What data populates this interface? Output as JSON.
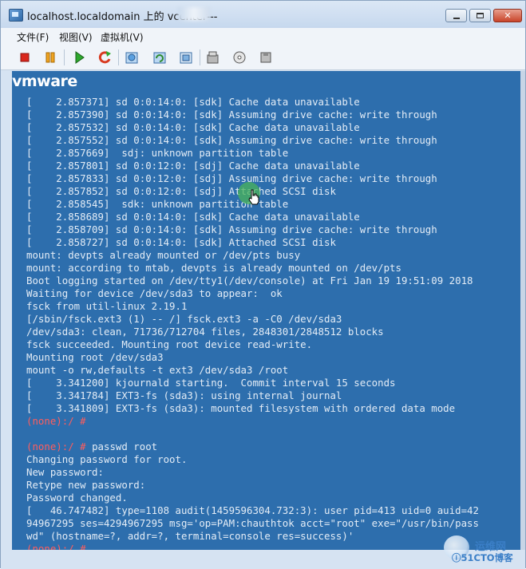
{
  "window": {
    "title": "localhost.localdomain 上的 vcenter---",
    "controls": {
      "minimize": "",
      "maximize": "",
      "close": "✕"
    }
  },
  "menubar": [
    "文件(F)",
    "视图(V)",
    "虚拟机(V)"
  ],
  "toolbar": {
    "buttons": [
      "stop-icon",
      "pause-icon",
      "play-icon",
      "reset-icon",
      "snapshot-icon",
      "revert-snapshot-icon",
      "manage-snapshots-icon",
      "vm-settings-icon",
      "cd-icon",
      "floppy-icon"
    ]
  },
  "console": {
    "logo": "vmware",
    "lines": [
      "[    2.857371] sd 0:0:14:0: [sdk] Cache data unavailable",
      "[    2.857390] sd 0:0:14:0: [sdk] Assuming drive cache: write through",
      "[    2.857532] sd 0:0:14:0: [sdk] Cache data unavailable",
      "[    2.857552] sd 0:0:14:0: [sdk] Assuming drive cache: write through",
      "[    2.857669]  sdj: unknown partition table",
      "[    2.857801] sd 0:0:12:0: [sdj] Cache data unavailable",
      "[    2.857833] sd 0:0:12:0: [sdj] Assuming drive cache: write through",
      "[    2.857852] sd 0:0:12:0: [sdj] Attached SCSI disk",
      "[    2.858545]  sdk: unknown partition table",
      "[    2.858689] sd 0:0:14:0: [sdk] Cache data unavailable",
      "[    2.858709] sd 0:0:14:0: [sdk] Assuming drive cache: write through",
      "[    2.858727] sd 0:0:14:0: [sdk] Attached SCSI disk",
      "mount: devpts already mounted or /dev/pts busy",
      "mount: according to mtab, devpts is already mounted on /dev/pts",
      "Boot logging started on /dev/tty1(/dev/console) at Fri Jan 19 19:51:09 2018",
      "Waiting for device /dev/sda3 to appear:  ok",
      "fsck from util-linux 2.19.1",
      "[/sbin/fsck.ext3 (1) -- /] fsck.ext3 -a -C0 /dev/sda3",
      "/dev/sda3: clean, 71736/712704 files, 2848301/2848512 blocks",
      "fsck succeeded. Mounting root device read-write.",
      "Mounting root /dev/sda3",
      "mount -o rw,defaults -t ext3 /dev/sda3 /root",
      "[    3.341200] kjournald starting.  Commit interval 15 seconds",
      "[    3.341784] EXT3-fs (sda3): using internal journal",
      "[    3.341809] EXT3-fs (sda3): mounted filesystem with ordered data mode",
      "(none):/ #",
      "",
      "(none):/ # passwd root",
      "Changing password for root.",
      "New password:",
      "Retype new password:",
      "Password changed.",
      "[   46.747482] type=1108 audit(1459596304.732:3): user pid=413 uid=0 auid=42",
      "94967295 ses=4294967295 msg='op=PAM:chauthtok acct=\"root\" exe=\"/usr/bin/pass",
      "wd\" (hostname=?, addr=?, terminal=console res=success)'",
      "(none):/ #"
    ],
    "prompt": "(none):/ #",
    "passwd_command": " passwd root"
  },
  "watermark": {
    "cn": "运维网",
    "en": "ⓘ51CTO博客"
  },
  "colors": {
    "console_bg": "#2d6ead",
    "console_text": "#e3ecf6",
    "prompt": "#ff5d5d",
    "titlebar": "#c6d8ee"
  }
}
